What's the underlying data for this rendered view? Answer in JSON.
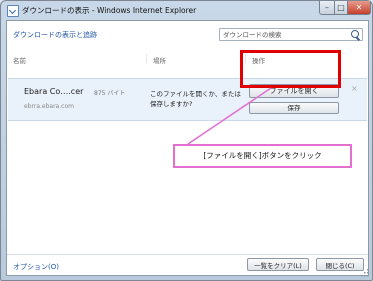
{
  "window": {
    "title": "ダウンロードの表示 - Windows Internet Explorer",
    "minimize_glyph": "–",
    "maximize_glyph": "□",
    "close_glyph": "✕"
  },
  "header": {
    "link": "ダウンロードの表示と追跡",
    "search_placeholder": "ダウンロードの検索"
  },
  "columns": {
    "name": "名前",
    "location": "場所",
    "action": "操作"
  },
  "download": {
    "filename": "Ebara Co….cer",
    "size": "875 バイト",
    "url": "ebrra.ebara.com",
    "message": "このファイルを開くか、または保存しますか?",
    "open_label": "ファイルを開く",
    "save_label": "保存",
    "dismiss_glyph": "×"
  },
  "callout": {
    "text": "[ファイルを開く]ボタンをクリック"
  },
  "footer": {
    "options_link": "オプション(O)",
    "clear_label": "一覧をクリア(L)",
    "close_label": "閉じる(C)"
  },
  "colors": {
    "highlight": "#e00000",
    "callout_border": "#e36fd0",
    "link": "#1f56a8"
  }
}
